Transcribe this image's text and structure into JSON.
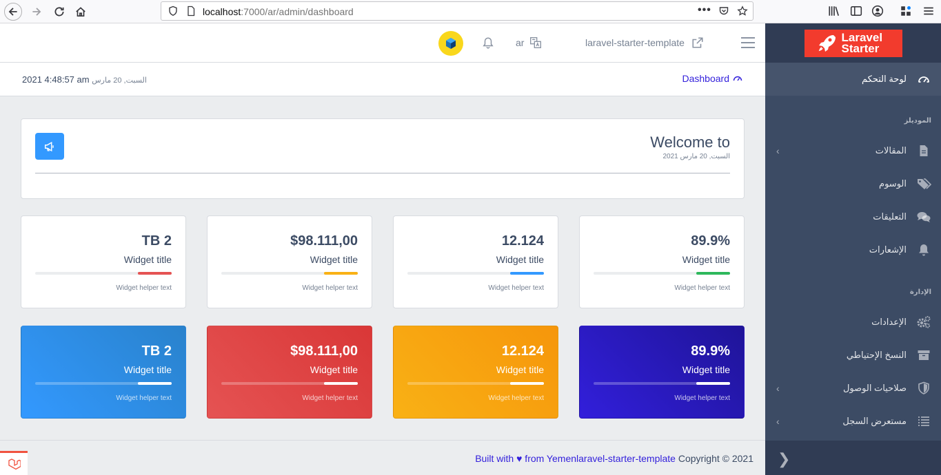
{
  "browser": {
    "url_host": "localhost",
    "url_path": ":7000/ar/admin/dashboard"
  },
  "sidebar": {
    "brand_line1": "Laravel",
    "brand_line2": "Starter",
    "items": [
      {
        "label": "لوحة التحكم",
        "icon": "speedometer-icon",
        "active": true
      },
      {
        "label": "المقالات",
        "icon": "file-icon",
        "has_children": true
      },
      {
        "label": "الوسوم",
        "icon": "tags-icon"
      },
      {
        "label": "التعليقات",
        "icon": "comments-icon"
      },
      {
        "label": "الإشعارات",
        "icon": "bell-icon"
      },
      {
        "label": "الإعدادات",
        "icon": "cogs-icon"
      },
      {
        "label": "النسخ الإحتياطي",
        "icon": "archive-icon"
      },
      {
        "label": "صلاحيات الوصول",
        "icon": "shield-icon",
        "has_children": true
      },
      {
        "label": "مستعرض السجل",
        "icon": "list-icon",
        "has_children": true
      }
    ],
    "section_modules": "الموديلز",
    "section_admin": "الإدارة",
    "toggle_glyph": "❯"
  },
  "header": {
    "app_link": "laravel-starter-template",
    "lang": "ar"
  },
  "subheader": {
    "breadcrumb": "Dashboard",
    "date_small": "السبت, 20 مارس",
    "date_rest": " 2021 4:48:57 am"
  },
  "welcome": {
    "title": "Welcome to",
    "subtitle": "السبت, 20 مارس 2021"
  },
  "widgets_light": [
    {
      "value": "TB 2",
      "title": "Widget title",
      "help": "Widget helper text",
      "progress": 0.25,
      "color": "#e55353"
    },
    {
      "value": "$98.111,00",
      "title": "Widget title",
      "help": "Widget helper text",
      "progress": 0.25,
      "color": "#f9b115"
    },
    {
      "value": "12.124",
      "title": "Widget title",
      "help": "Widget helper text",
      "progress": 0.25,
      "color": "#39f"
    },
    {
      "value": "89.9%",
      "title": "Widget title",
      "help": "Widget helper text",
      "progress": 0.25,
      "color": "#2eb85c"
    }
  ],
  "widgets_dark": [
    {
      "value": "TB 2",
      "title": "Widget title",
      "help": "Widget helper text",
      "progress": 0.25,
      "bg_from": "#39f",
      "bg_to": "#2982cc"
    },
    {
      "value": "$98.111,00",
      "title": "Widget title",
      "help": "Widget helper text",
      "progress": 0.25,
      "bg_from": "#e55353",
      "bg_to": "#d93737"
    },
    {
      "value": "12.124",
      "title": "Widget title",
      "help": "Widget helper text",
      "progress": 0.25,
      "bg_from": "#f9b115",
      "bg_to": "#f6960b"
    },
    {
      "value": "89.9%",
      "title": "Widget title",
      "help": "Widget helper text",
      "progress": 0.25,
      "bg_from": "#321fdb",
      "bg_to": "#1f1498"
    }
  ],
  "footer": {
    "built_with": "Built with ♥ from Yemen",
    "app_link": "laravel-starter-template",
    "copyright": " Copyright © 2021"
  },
  "colors": {
    "accent": "#321fdb",
    "sidebar": "#3c4b64",
    "body": "#ebedef"
  }
}
